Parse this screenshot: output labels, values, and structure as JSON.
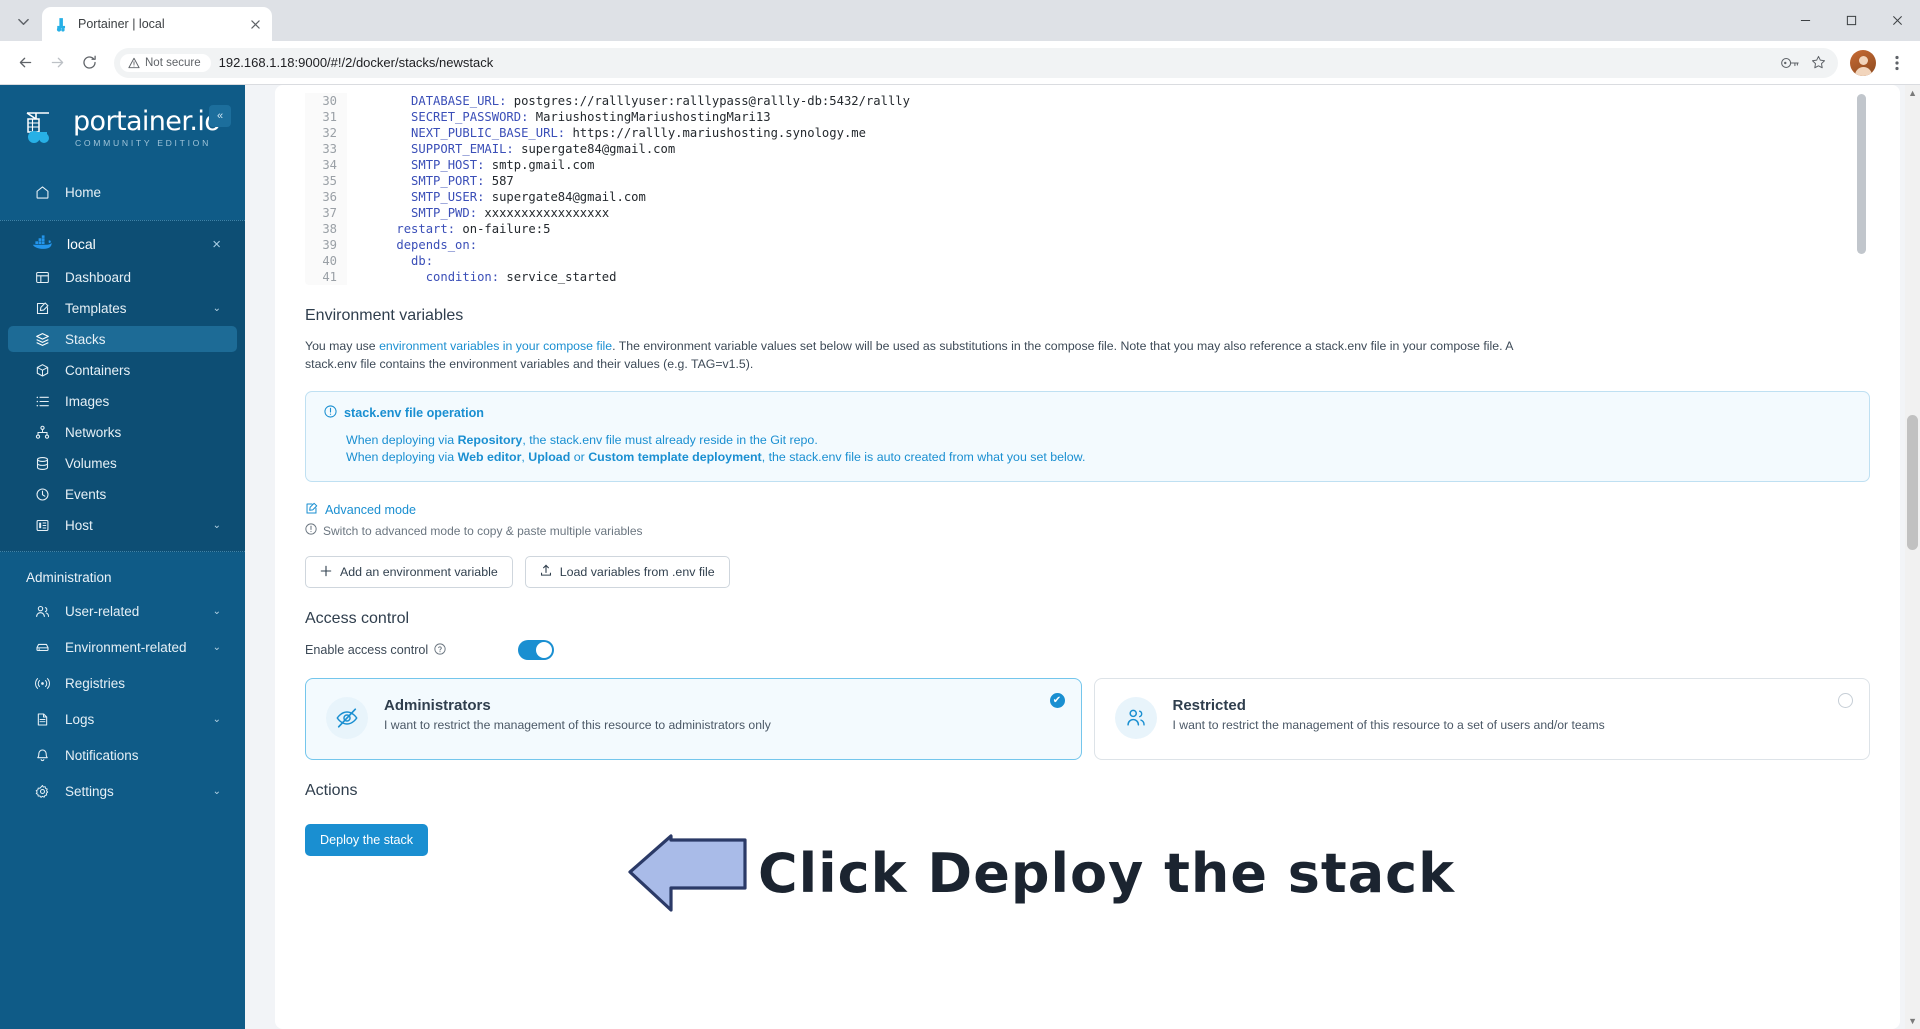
{
  "browser": {
    "tab": {
      "title": "Portainer | local",
      "favicon_name": "portainer-favicon"
    },
    "tab_list_tooltip": "Search tabs",
    "nav": {
      "back": "Back",
      "forward": "Forward",
      "reload": "Reload"
    },
    "security_label": "Not secure",
    "url": "192.168.1.18:9000/#!/2/docker/stacks/newstack",
    "window": {
      "minimize": "–",
      "maximize": "☐",
      "close": "✕"
    }
  },
  "sidebar": {
    "brand_name": "portainer.io",
    "brand_sub": "COMMUNITY EDITION",
    "collapse_icon": "«",
    "home": {
      "label": "Home",
      "icon": "home-icon"
    },
    "environment": {
      "label": "local",
      "icon": "docker-icon",
      "close": "×"
    },
    "env_items": [
      {
        "label": "Dashboard",
        "icon": "dashboard-icon",
        "chevron": ""
      },
      {
        "label": "Templates",
        "icon": "templates-icon",
        "chevron": "⌄"
      },
      {
        "label": "Stacks",
        "icon": "stacks-icon",
        "chevron": ""
      },
      {
        "label": "Containers",
        "icon": "containers-icon",
        "chevron": ""
      },
      {
        "label": "Images",
        "icon": "images-icon",
        "chevron": ""
      },
      {
        "label": "Networks",
        "icon": "networks-icon",
        "chevron": ""
      },
      {
        "label": "Volumes",
        "icon": "volumes-icon",
        "chevron": ""
      },
      {
        "label": "Events",
        "icon": "events-icon",
        "chevron": ""
      },
      {
        "label": "Host",
        "icon": "host-icon",
        "chevron": "⌄"
      }
    ],
    "active_item": "Stacks",
    "admin_title": "Administration",
    "admin_items": [
      {
        "label": "User-related",
        "icon": "users-icon",
        "chevron": "⌄"
      },
      {
        "label": "Environment-related",
        "icon": "environment-icon",
        "chevron": "⌄"
      },
      {
        "label": "Registries",
        "icon": "registries-icon",
        "chevron": ""
      },
      {
        "label": "Logs",
        "icon": "logs-icon",
        "chevron": "⌄"
      },
      {
        "label": "Notifications",
        "icon": "bell-icon",
        "chevron": ""
      },
      {
        "label": "Settings",
        "icon": "gear-icon",
        "chevron": "⌄"
      }
    ]
  },
  "editor": {
    "lines": [
      {
        "n": "30",
        "indent": 6,
        "key": "DATABASE_URL:",
        "value": " postgres://ralllyuser:ralllypass@rallly-db:5432/rallly"
      },
      {
        "n": "31",
        "indent": 6,
        "key": "SECRET_PASSWORD:",
        "value": " MariushostingMariushostingMari13"
      },
      {
        "n": "32",
        "indent": 6,
        "key": "NEXT_PUBLIC_BASE_URL:",
        "value": " https://rallly.mariushosting.synology.me"
      },
      {
        "n": "33",
        "indent": 6,
        "key": "SUPPORT_EMAIL:",
        "value": " supergate84@gmail.com"
      },
      {
        "n": "34",
        "indent": 6,
        "key": "SMTP_HOST:",
        "value": " smtp.gmail.com"
      },
      {
        "n": "35",
        "indent": 6,
        "key": "SMTP_PORT:",
        "value": " 587"
      },
      {
        "n": "36",
        "indent": 6,
        "key": "SMTP_USER:",
        "value": " supergate84@gmail.com"
      },
      {
        "n": "37",
        "indent": 6,
        "key": "SMTP_PWD:",
        "value": " xxxxxxxxxxxxxxxxx"
      },
      {
        "n": "38",
        "indent": 4,
        "key": "restart:",
        "value": " on-failure:5"
      },
      {
        "n": "39",
        "indent": 4,
        "key": "depends_on:",
        "value": ""
      },
      {
        "n": "40",
        "indent": 6,
        "key": "db:",
        "value": ""
      },
      {
        "n": "41",
        "indent": 8,
        "key": "condition:",
        "value": " service_started"
      }
    ]
  },
  "env_section": {
    "title": "Environment variables",
    "desc_1": "You may use ",
    "desc_link": "environment variables in your compose file",
    "desc_2": ". The environment variable values set below will be used as substitutions in the compose file. Note that you may also reference a stack.env file in your compose file. A stack.env file contains the environment variables and their values (e.g. TAG=v1.5).",
    "info": {
      "icon": "info-circle-icon",
      "title": "stack.env file operation",
      "line1_a": "When deploying via ",
      "line1_b": "Repository",
      "line1_c": ", the stack.env file must already reside in the Git repo.",
      "line2_a": "When deploying via ",
      "line2_b": "Web editor",
      "line2_c": "Upload",
      "line2_d": "Custom template deployment",
      "line2_e": ", the stack.env file is auto created from what you set below.",
      "line2_or": " or "
    },
    "advanced_mode_label": "Advanced mode",
    "advanced_mode_icon": "edit-square-icon",
    "advanced_mode_hint": "Switch to advanced mode to copy & paste multiple variables",
    "add_variable_button": "Add an environment variable",
    "add_variable_icon": "plus-icon",
    "load_env_button": "Load variables from .env file",
    "load_env_icon": "upload-icon"
  },
  "access_control": {
    "title": "Access control",
    "toggle_label": "Enable access control",
    "toggle_help_icon": "question-circle-icon",
    "toggle_on": true,
    "cards": [
      {
        "title": "Administrators",
        "desc": "I want to restrict the management of this resource to administrators only",
        "icon": "eye-off-icon",
        "selected": true,
        "check": "✔"
      },
      {
        "title": "Restricted",
        "desc": "I want to restrict the management of this resource to a set of users and/or teams",
        "icon": "users-group-icon",
        "selected": false,
        "check": ""
      }
    ]
  },
  "actions": {
    "title": "Actions",
    "deploy_button": "Deploy the stack"
  },
  "annotation": {
    "arrow_icon": "left-arrow-annotation",
    "text": "Click Deploy the stack",
    "arrow_fill": "#a9bbe8",
    "arrow_stroke": "#2b3a67"
  },
  "colors": {
    "sidebar_bg": "#0f5b87",
    "accent": "#1a8fd1",
    "page_bg": "#f2f4f7"
  }
}
